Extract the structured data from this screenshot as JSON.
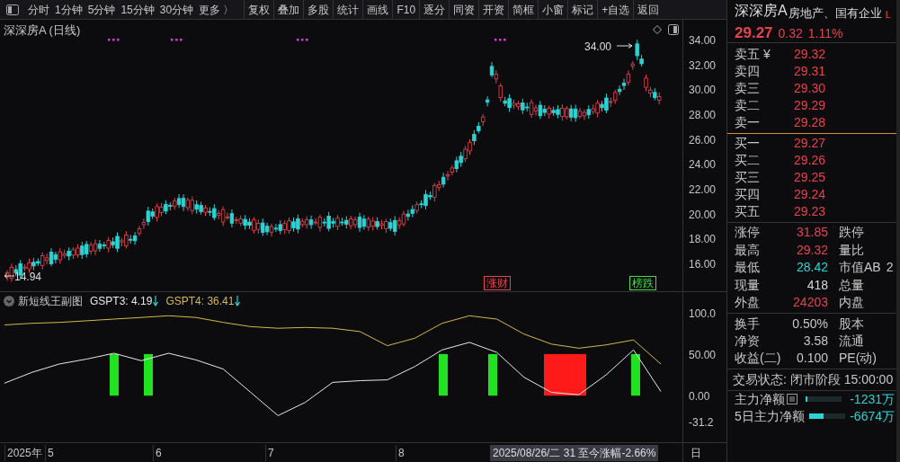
{
  "toolbar": {
    "periods": [
      "分时",
      "1分钟",
      "5分钟",
      "15分钟",
      "30分钟",
      "更多 〉"
    ],
    "buttons": [
      "复权",
      "叠加",
      "多股",
      "统计",
      "画线",
      "F10",
      "逐分",
      "同资",
      "开资",
      "简框",
      "小窗",
      "标记",
      "+自选",
      "返回"
    ]
  },
  "chart": {
    "title": "深深房A (日线)",
    "high_label": "34.00",
    "low_label": "14.94",
    "price_axis": [
      "34.00",
      "32.00",
      "30.00",
      "28.00",
      "26.00",
      "24.00",
      "22.00",
      "20.00",
      "18.00",
      "16.00"
    ],
    "tags": [
      {
        "text": "涨财",
        "color": "#e8424f"
      },
      {
        "text": "榜跌",
        "color": "#3ee03e"
      }
    ]
  },
  "indicator": {
    "name": "新短线王副图",
    "readouts": [
      ": 4.19",
      ": 36.41"
    ],
    "chart_data": {
      "type": "line",
      "ylim": [
        -56,
        105
      ],
      "yticks": [
        {
          "value": 100,
          "label": "100.0"
        },
        {
          "value": 50,
          "label": "50.00"
        },
        {
          "value": 0,
          "label": "0.00"
        },
        {
          "value": -31.2,
          "label": "-31.2"
        }
      ],
      "series": [
        {
          "name": "GSPT3",
          "color": "#e8e8e8",
          "values": [
            15,
            28,
            38,
            44,
            51,
            42,
            51,
            43,
            32,
            4,
            -24,
            -8,
            16,
            18,
            19,
            35,
            55,
            64,
            52,
            22,
            4,
            1,
            25,
            55,
            5
          ]
        },
        {
          "name": "GSPT4",
          "color": "#d4b84a",
          "values": [
            85,
            87,
            88,
            90,
            92,
            94,
            96,
            94,
            88,
            83,
            81,
            82,
            81,
            77,
            60,
            69,
            87,
            96,
            92,
            74,
            62,
            57,
            61,
            67,
            38
          ]
        }
      ]
    }
  },
  "x_axis": {
    "labels": [
      "2025年",
      "5",
      "6",
      "7",
      "8"
    ],
    "info": "2025/08/26/二 31 至今涨幅-2.66%",
    "period": "日"
  },
  "quote": {
    "name": "深深房A",
    "sector": "房地产、国有企业",
    "flag": "L",
    "price": "29.27",
    "change": "0.32",
    "percent": "1.11%",
    "asks": [
      {
        "label": "卖五 ¥",
        "price": "29.32"
      },
      {
        "label": "卖四",
        "price": "29.31"
      },
      {
        "label": "卖三",
        "price": "29.30"
      },
      {
        "label": "卖二",
        "price": "29.29"
      },
      {
        "label": "卖一",
        "price": "29.28"
      }
    ],
    "bids": [
      {
        "label": "买一",
        "price": "29.27"
      },
      {
        "label": "买二",
        "price": "29.26"
      },
      {
        "label": "买三",
        "price": "29.25"
      },
      {
        "label": "买四",
        "price": "29.24"
      },
      {
        "label": "买五",
        "price": "29.23"
      }
    ],
    "stats": [
      {
        "label": "涨停",
        "value": "31.85",
        "color": "#e8424f",
        "label2": "跌停"
      },
      {
        "label": "最高",
        "value": "29.32",
        "color": "#e8424f",
        "label2": "量比"
      },
      {
        "label": "最低",
        "value": "28.42",
        "color": "#2ad4d4",
        "label2": "市值AB",
        "value2": "2"
      },
      {
        "label": "现量",
        "value": "418",
        "color": "#d8d8d8",
        "label2": "总量"
      },
      {
        "label": "外盘",
        "value": "24203",
        "color": "#e8424f",
        "label2": "内盘"
      }
    ],
    "stats2": [
      {
        "label": "换手",
        "value": "0.50%",
        "label2": "股本"
      },
      {
        "label": "净资",
        "value": "3.58",
        "label2": "流通"
      },
      {
        "label": "收益(二)",
        "value": "0.100",
        "label2": "PE(动)"
      }
    ],
    "status": "交易状态: 闭市阶段 15:00:00",
    "flows": [
      {
        "label": "主力净额",
        "value": "-1231万",
        "level": 0.05
      },
      {
        "label": "5日主力净额",
        "value": "-6674万",
        "level": 0.4
      }
    ]
  }
}
